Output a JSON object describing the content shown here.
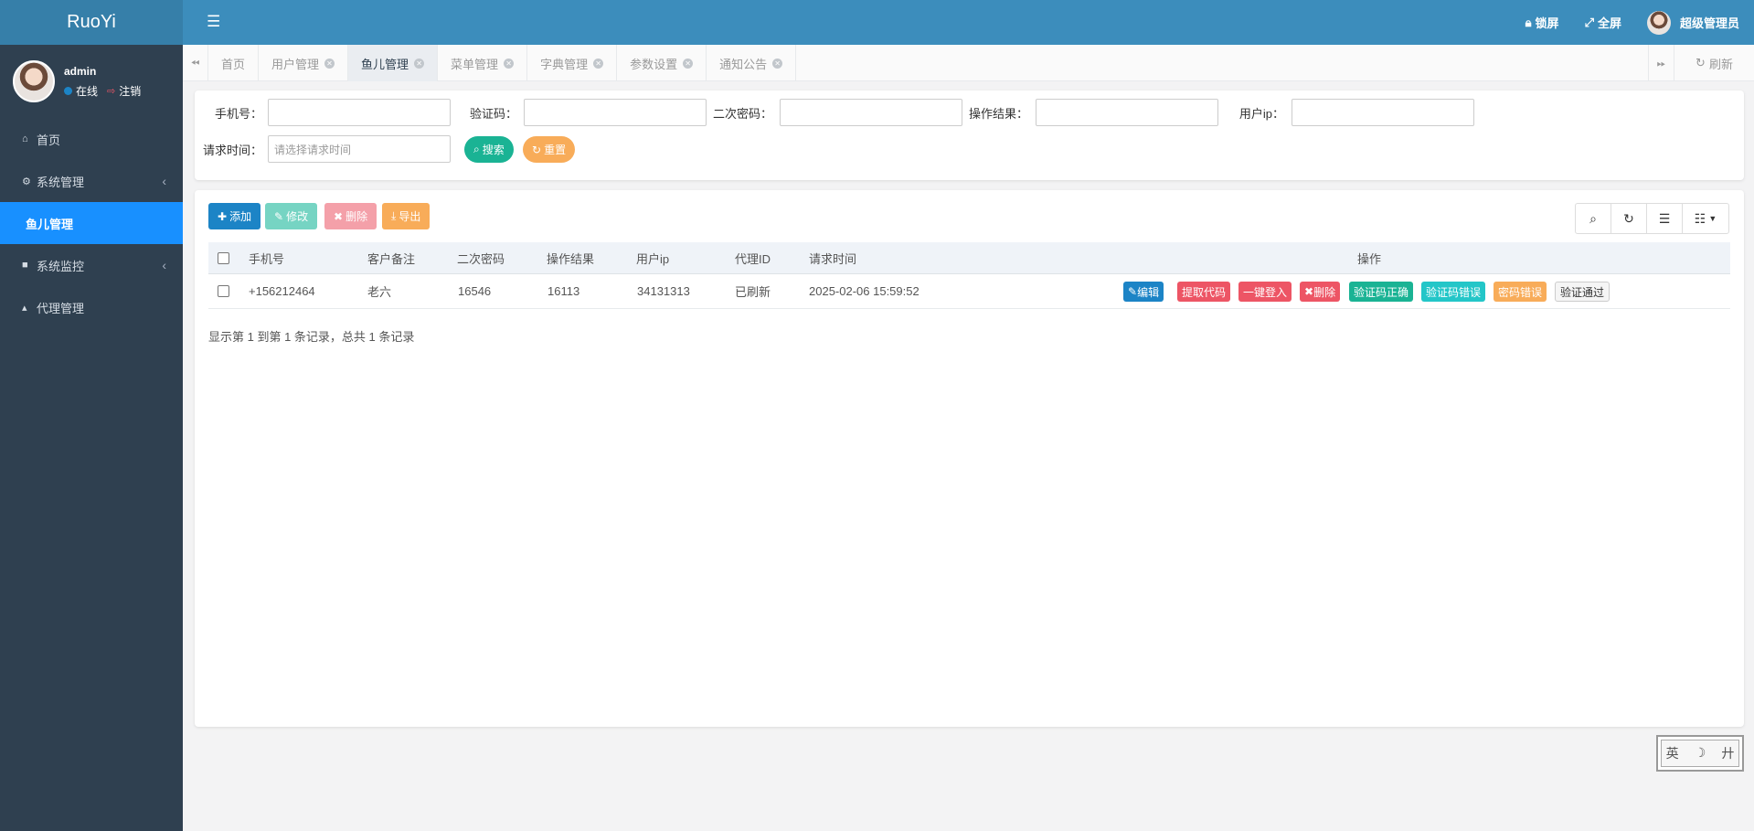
{
  "app": {
    "logo": "RuoYi"
  },
  "user": {
    "name": "admin",
    "status": "在线",
    "logout": "注销"
  },
  "sidebar": {
    "items": [
      {
        "label": "首页",
        "icon": "home-icon"
      },
      {
        "label": "系统管理",
        "icon": "gear-icon"
      },
      {
        "label": "鱼儿管理",
        "icon": ""
      },
      {
        "label": "系统监控",
        "icon": "video-icon"
      },
      {
        "label": "代理管理",
        "icon": "user-icon"
      }
    ]
  },
  "topbar": {
    "lock": "锁屏",
    "fullscreen": "全屏",
    "admin": "超级管理员"
  },
  "tabs": {
    "items": [
      "首页",
      "用户管理",
      "鱼儿管理",
      "菜单管理",
      "字典管理",
      "参数设置",
      "通知公告"
    ],
    "active": "鱼儿管理",
    "refresh": "刷新"
  },
  "search": {
    "phone_label": "手机号：",
    "code_label": "验证码：",
    "pwd2_label": "二次密码：",
    "result_label": "操作结果：",
    "ip_label": "用户ip：",
    "time_label": "请求时间：",
    "time_placeholder": "请选择请求时间",
    "search_btn": "搜索",
    "reset_btn": "重置"
  },
  "toolbar": {
    "add": "添加",
    "edit": "修改",
    "delete": "删除",
    "export": "导出"
  },
  "table": {
    "headers": [
      "手机号",
      "客户备注",
      "二次密码",
      "操作结果",
      "用户ip",
      "代理ID",
      "请求时间",
      "操作"
    ],
    "rows": [
      {
        "phone": "+156212464",
        "remark": "老六",
        "pwd2": "16546",
        "result": "16113",
        "ip": "34131313",
        "agent": "已刷新",
        "time": "2025-02-06 15:59:52"
      }
    ],
    "actions": [
      "编辑",
      "提取代码",
      "一键登入",
      "删除",
      "验证码正确",
      "验证码错误",
      "密码错误",
      "验证通过"
    ]
  },
  "pagination": {
    "summary": "显示第 1 到第 1 条记录，总共 1 条记录"
  },
  "ime": {
    "a": "英",
    "b": "☽",
    "c": "廾"
  },
  "colors": {
    "sidebar": "#2f4050",
    "topbar": "#3c8dbc",
    "active": "#1890ff",
    "primary": "#1c84c6",
    "success": "#1ab394",
    "warning": "#f8ac59",
    "danger": "#ed5565",
    "info": "#23c6c8"
  }
}
